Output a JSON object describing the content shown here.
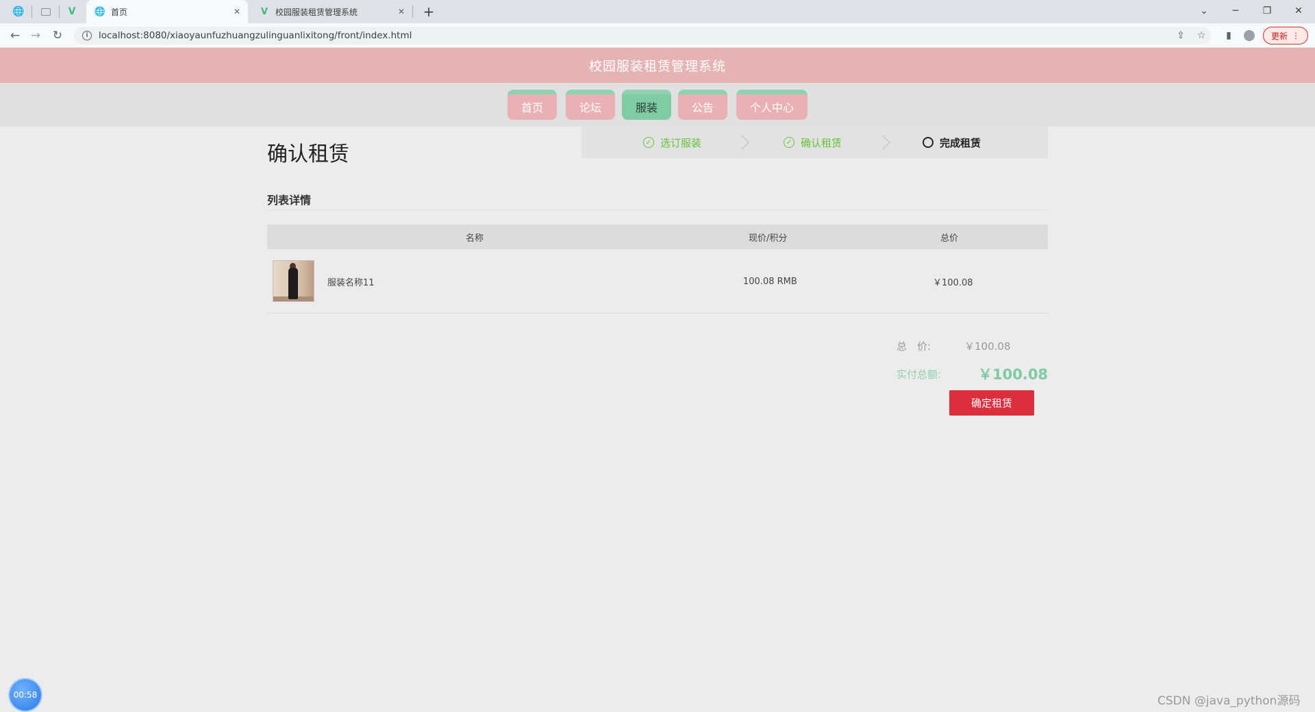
{
  "browser": {
    "tabs": [
      {
        "label": "首页",
        "icon": "globe-icon",
        "active": true
      },
      {
        "label": "校园服装租赁管理系统",
        "icon": "vue-logo-icon",
        "active": false
      }
    ],
    "url": "localhost:8080/xiaoyaunfuzhuangzulinguanlixitong/front/index.html",
    "update_label": "更新"
  },
  "site": {
    "title": "校园服装租赁管理系统",
    "nav": [
      {
        "label": "首页",
        "active": false
      },
      {
        "label": "论坛",
        "active": false
      },
      {
        "label": "服装",
        "active": true
      },
      {
        "label": "公告",
        "active": false
      },
      {
        "label": "个人中心",
        "active": false
      }
    ]
  },
  "page": {
    "heading": "确认租赁",
    "steps": [
      {
        "label": "选订服装",
        "status": "done"
      },
      {
        "label": "确认租赁",
        "status": "done"
      },
      {
        "label": "完成租赁",
        "status": "todo"
      }
    ],
    "section_title": "列表详情",
    "table": {
      "headers": [
        "名称",
        "现价/积分",
        "总价"
      ],
      "rows": [
        {
          "name": "服装名称11",
          "price": "100.08 RMB",
          "total": "￥100.08"
        }
      ]
    },
    "summary": {
      "total_label": "总　价:",
      "total_value": "￥100.08",
      "pay_label": "实付总额:",
      "pay_value": "￥100.08"
    },
    "confirm_label": "确定租赁"
  },
  "overlay": {
    "timer": "00:58",
    "watermark": "CSDN @java_python源码"
  },
  "colors": {
    "header_bg": "#e5b3b3",
    "nav_pink": "#e9b1b5",
    "nav_green": "#7ecba4",
    "step_done": "#67c23a",
    "confirm_red": "#dc2f3e"
  }
}
